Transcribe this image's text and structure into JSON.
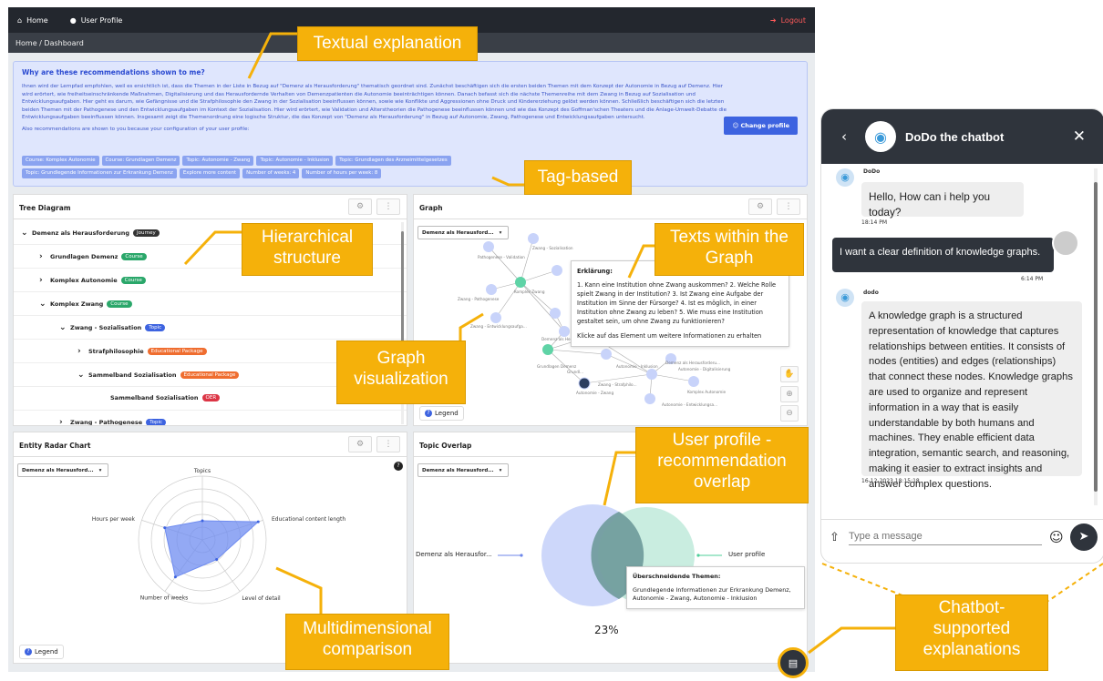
{
  "nav": {
    "home": "Home",
    "profile": "User Profile",
    "logout": "Logout",
    "breadcrumb": "Home / Dashboard"
  },
  "explanation": {
    "title": "Why are these recommendations shown to me?",
    "paragraph": "Ihnen wird der Lernpfad empfohlen, weil es ersichtlich ist, dass die Themen in der Liste in Bezug auf \"Demenz als Herausforderung\" thematisch geordnet sind. Zunächst beschäftigen sich die ersten beiden Themen mit dem Konzept der Autonomie in Bezug auf Demenz. Hier wird erörtert, wie freiheitseinschränkende Maßnahmen, Digitalisierung und das Herausfordernde Verhalten von Demenzpatienten die Autonomie beeinträchtigen können. Danach befasst sich die nächste Themenreihe mit dem Zwang in Bezug auf Sozialisation und Entwicklungsaufgaben. Hier geht es darum, wie Gefängnisse und die Strafphilosophie den Zwang in der Sozialisation beeinflussen können, sowie wie Konflikte und Aggressionen ohne Druck und Kindererziehung gelöst werden können. Schließlich beschäftigen sich die letzten beiden Themen mit der Pathogenese und den Entwicklungsaufgaben im Kontext der Sozialisation. Hier wird erörtert, wie Validation und Alterstheorien die Pathogenese beeinflussen können und wie das Konzept des Goffman'schen Theaters und die Anlage-Umwelt-Debatte die Entwicklungsaufgaben beeinflussen können. Insgesamt zeigt die Themenordnung eine logische Struktur, die das Konzept von \"Demenz als Herausforderung\" in Bezug auf Autonomie, Zwang, Pathogenese und Entwicklungsaufgaben untersucht.",
    "also": "Also recommendations are shown to you because your configuration of your user profile:",
    "tags": [
      "Course: Komplex Autonomie",
      "Course: Grundlagen Demenz",
      "Topic: Autonomie - Zwang",
      "Topic: Autonomie - Inklusion",
      "Topic: Grundlagen des Arzneimittelgesetzes",
      "Topic: Grundlegende Informationen zur Erkrankung Demenz",
      "Explore more content",
      "Number of weeks: 4",
      "Number of hours per week: 8"
    ],
    "change_profile": "Change profile"
  },
  "tree": {
    "title": "Tree Diagram",
    "nodes": [
      {
        "label": "Demenz als Herausforderung",
        "badge": "Journey"
      },
      {
        "label": "Grundlagen Demenz",
        "badge": "Course"
      },
      {
        "label": "Komplex Autonomie",
        "badge": "Course"
      },
      {
        "label": "Komplex Zwang",
        "badge": "Course"
      },
      {
        "label": "Zwang - Sozialisation",
        "badge": "Topic"
      },
      {
        "label": "Strafphilosophie",
        "badge": "Educational Package"
      },
      {
        "label": "Sammelband Sozialisation",
        "badge": "Educational Package"
      },
      {
        "label": "Sammelband Sozialisation",
        "badge": "OER"
      },
      {
        "label": "Zwang - Pathogenese",
        "badge": "Topic"
      }
    ]
  },
  "graph": {
    "title": "Graph",
    "select": "Demenz als Herausford...",
    "legend": "Legend",
    "labels": [
      "Zwang - Sozialisation",
      "Pathogenese - Validation",
      "Komplex Zwang",
      "Zwang - Pathogenese",
      "Zwang - Entwicklungsaufga...",
      "Demenz als Herausford...",
      "Grundlagen Demenz",
      "Autonomie - Zwang",
      "Autonomie - Inklusion",
      "Komplex Autonomie",
      "Autonomie - Entwicklungsa...",
      "Autonomie - Digitalisierung",
      "Zwang - Strafphilo...",
      "Grundl...",
      "Demenz als Herausforderu..."
    ],
    "tooltip_title": "Erklärung:",
    "tooltip_body": "1. Kann eine Institution ohne Zwang auskommen? 2. Welche Rolle spielt Zwang in der Institution? 3. Ist Zwang eine Aufgabe der Institution im Sinne der Fürsorge? 4. Ist es möglich, in einer Institution ohne Zwang zu leben? 5. Wie muss eine Institution gestaltet sein, um ohne Zwang zu funktionieren?",
    "tooltip_hint": "Klicke auf das Element um weitere Informationen zu erhalten"
  },
  "radar": {
    "title": "Entity Radar Chart",
    "select": "Demenz als Herausford...",
    "legend": "Legend",
    "axes": [
      "Topics",
      "Educational content length",
      "Level of detail",
      "Number of weeks",
      "Hours per week"
    ],
    "values": [
      0.3,
      0.92,
      0.38,
      0.72,
      0.62
    ]
  },
  "overlap": {
    "title": "Topic Overlap",
    "select": "Demenz als Herausford...",
    "left_label": "Demenz als Herausfor...",
    "right_label": "User profile",
    "tip_title": "Überschneidende Themen:",
    "tip_body": "Grundlegende Informationen zur Erkrankung Demenz, Autonomie - Zwang, Autonomie - Inklusion",
    "percent": "23%"
  },
  "callouts": {
    "textual": "Textual explanation",
    "tag": "Tag-based",
    "hier": "Hierarchical structure",
    "texts": "Texts within the Graph",
    "graphvis": "Graph visualization",
    "overlap": "User profile - recommendation overlap",
    "multi": "Multidimensional comparison",
    "chatbot": "Chatbot-supported explanations"
  },
  "chat": {
    "title": "DoDo the chatbot",
    "bot_name1": "DoDo",
    "msg1": "Hello, How can i help you today?",
    "time1": "18:14 PM",
    "user_msg": "I want a clear definition of knowledge graphs.",
    "time2": "6:14 PM",
    "bot_name2": "dodo",
    "msg2": "A knowledge graph is a structured representation of knowledge that captures relationships between entities. It consists of nodes (entities) and edges (relationships) that connect these nodes. Knowledge graphs are used to organize and represent information in a way that is easily understandable by both humans and machines. They enable efficient data integration, semantic search, and reasoning, making it easier to extract insights and answer complex questions.",
    "time3": "16-12-2023 18:15:18",
    "placeholder": "Type a message"
  }
}
